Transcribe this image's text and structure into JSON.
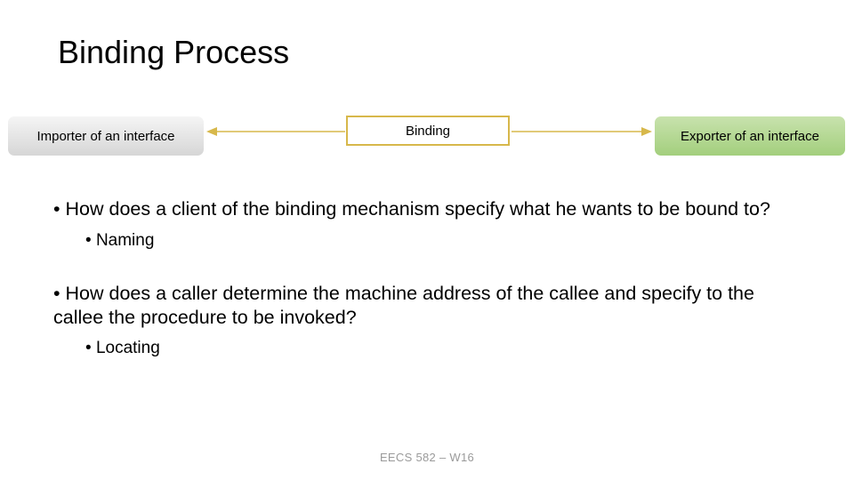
{
  "title": "Binding Process",
  "diagram": {
    "importer": "Importer of an interface",
    "binding": "Binding",
    "exporter": "Exporter of an interface"
  },
  "bullets": {
    "q1": "How does a client of the binding mechanism specify what he wants to be bound to?",
    "q1_sub": "Naming",
    "q2": "How does a caller determine the machine address of the callee and specify to the callee the procedure to be invoked?",
    "q2_sub": "Locating"
  },
  "footer": "EECS 582 – W16"
}
